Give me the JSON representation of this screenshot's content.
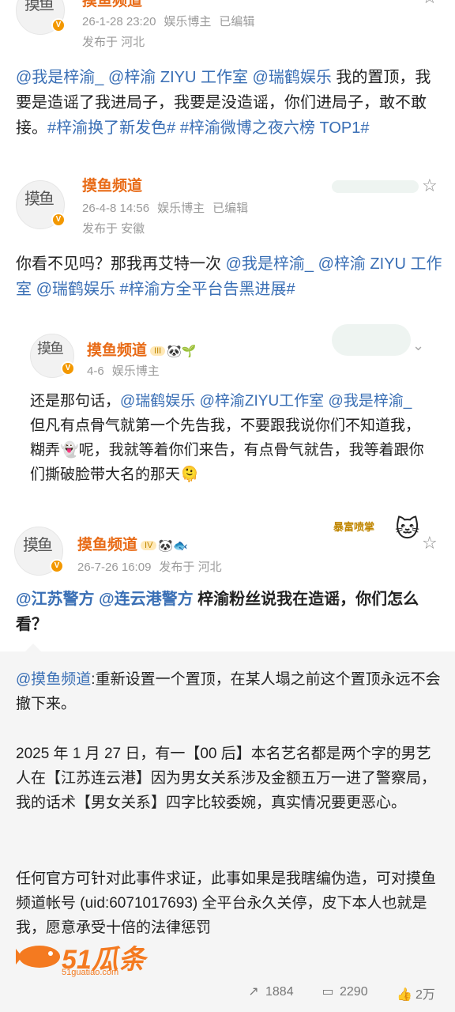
{
  "posts": [
    {
      "author": "摸鱼频道",
      "date": "26-1-28 23:20",
      "role": "娱乐博主",
      "edited": "已编辑",
      "location": "发布于 河北",
      "text_parts": [
        "@我是梓渝_",
        " ",
        "@梓渝 ZIYU 工作室",
        " ",
        "@瑞鹤娱乐",
        " 我的置顶，我要是造谣了我进局子，我要是没造谣，你们进局子，敢不敢接。",
        "#梓渝换了新发色#",
        " ",
        "#梓渝微博之夜六榜 TOP1#"
      ]
    },
    {
      "author": "摸鱼频道",
      "date": "26-4-8 14:56",
      "role": "娱乐博主",
      "edited": "已编辑",
      "location": "发布于 安徽",
      "text_parts": [
        "你看不见吗？那我再艾特一次 ",
        "@我是梓渝_",
        " ",
        "@梓渝 ZIYU 工作室",
        " ",
        "@瑞鹤娱乐",
        " ",
        "#梓渝方全平台告黑进展#"
      ]
    }
  ],
  "sub_post": {
    "author": "摸鱼频道",
    "badge": "III",
    "date": "4-6",
    "role": "娱乐博主",
    "text_parts": [
      "还是那句话，",
      "@瑞鹤娱乐",
      " ",
      "@梓渝ZIYU工作室",
      " ",
      "@我是梓渝_",
      " 但凡有点骨气就第一个先告我，不要跟我说你们不知道我，糊弄👻呢，我就等着你们来告，有点骨气就告，我等着跟你们撕破脸带大名的那天🫠"
    ]
  },
  "main_post": {
    "author": "摸鱼频道",
    "badge": "IV",
    "date": "26-7-26 16:09",
    "location": "发布于 河北",
    "decoration_text": "暴富喷掌",
    "text_parts": [
      "@江苏警方",
      " ",
      "@连云港警方",
      " 梓渝粉丝说我在造谣，你们怎么看？"
    ]
  },
  "quoted": {
    "mention": "@摸鱼频道",
    "p1": ":重新设置一个置顶，在某人塌之前这个置顶永远不会撤下来。",
    "p2": "2025 年 1 月 27 日，有一【00 后】本名艺名都是两个字的男艺人在【江苏连云港】因为男女关系涉及金额五万一进了警察局，我的话术【男女关系】四字比较委婉，真实情况要更恶心。",
    "p3": "任何官方可针对此事件求证，此事如果是我瞎编伪造，可对摸鱼频道帐号 (uid:6071017693) 全平台永久关停，皮下本人也就是我，愿意承受十倍的法律惩罚"
  },
  "actions": {
    "repost": "1884",
    "comment": "2290",
    "like": "2万"
  },
  "watermark": {
    "brand": "51瓜条",
    "site": "51guatiao.com"
  },
  "colors": {
    "mention": "#3a6fb5",
    "author": "#e86b17",
    "meta": "#9a9a9a",
    "quote_bg": "#f5f5f5"
  },
  "icons": [
    "star-icon",
    "chevron-down-icon",
    "repost-icon",
    "comment-icon",
    "like-icon",
    "verified-badge-icon"
  ]
}
